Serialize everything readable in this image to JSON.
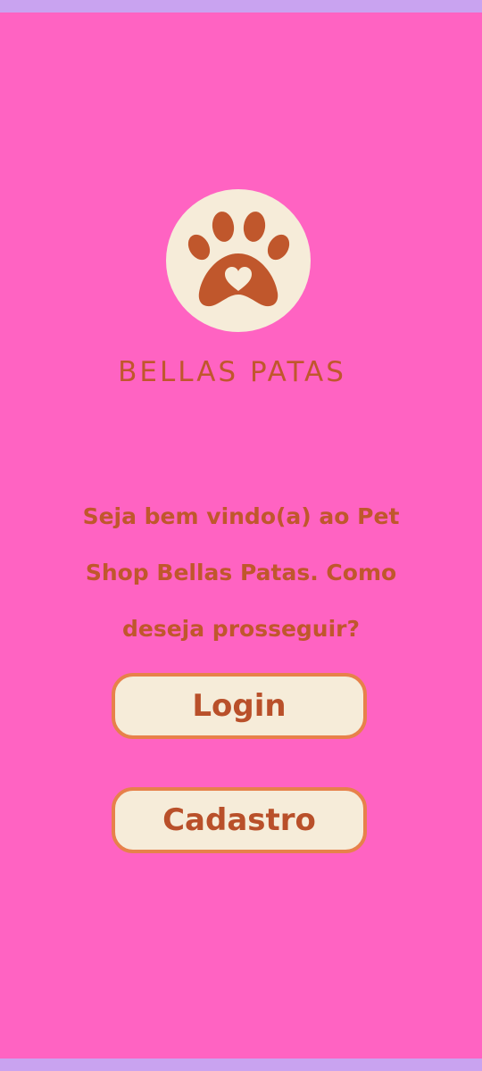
{
  "brand": {
    "name": "BELLAS PATAS",
    "logo_icon": "paw-heart-icon"
  },
  "welcome": {
    "text": "Seja bem vindo(a) ao Pet Shop Bellas Patas. Como deseja prosseguir?"
  },
  "actions": {
    "login_label": "Login",
    "signup_label": "Cadastro"
  },
  "colors": {
    "background": "#ff63c2",
    "frame": "#c9a3f0",
    "accent": "#c0572c",
    "button_fill": "#f6ecd9",
    "button_border": "#e7814a"
  }
}
